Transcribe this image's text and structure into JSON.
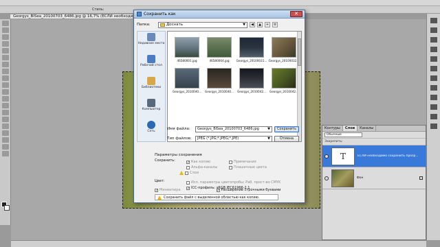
{
  "document": {
    "tab_title": "Georgys_BlSea_20100703_6486.jpg @ 16,7% (ЕСЛИ необходимо сохрани"
  },
  "options_bar": {
    "style_label": "Стиль:"
  },
  "dialog": {
    "title": "Сохранить как",
    "folder_label": "Папка:",
    "folder_value": "Доснать",
    "places": [
      {
        "label": "Недавние места",
        "color": "#6a8bb8"
      },
      {
        "label": "Рабочий стол",
        "color": "#4a7cc4"
      },
      {
        "label": "Библиотеки",
        "color": "#d6a84a"
      },
      {
        "label": "Компьютер",
        "color": "#5a6a7a"
      },
      {
        "label": "Сеть",
        "color": "#2a6ab0"
      }
    ],
    "files": [
      {
        "name": "46580001.jpg",
        "color": "#5e6f7a"
      },
      {
        "name": "46580004.jpg",
        "color": "#3f5a3a"
      },
      {
        "name": "Georgys_20100031...",
        "color": "#2a3340"
      },
      {
        "name": "Georgys_20100032...",
        "color": "#6b5a3f"
      },
      {
        "name": "Georgys_2010040...",
        "color": "#34424c"
      },
      {
        "name": "Georgys_2010040...",
        "color": "#5a4a3a"
      },
      {
        "name": "Georgys_2010042...",
        "color": "#2c2f36"
      },
      {
        "name": "Georgys_2010042...",
        "color": "#4a5a24"
      }
    ],
    "filename_label": "Имя файла:",
    "filename_value": "Georgys_BlSea_20100703_6486.jpg",
    "filetype_label": "Тип файлов:",
    "filetype_value": "JPEG (*.JPG;*.JPEG;*.JPE)",
    "save_button": "Сохранить",
    "cancel_button": "Отмена",
    "save_params_title": "Параметры сохранения",
    "save_label": "Сохранить:",
    "opt_copy": "Как копию",
    "opt_notes": "Примечания",
    "opt_alpha": "Альфа-каналы",
    "opt_spot": "Плашечные цвета",
    "opt_layers": "Слои",
    "color_label": "Цвет:",
    "opt_proof": "Исп. параметры цветопробы: Раб. прост-во CMYK",
    "opt_icc": "ICC-профиль: sRGB IEC61966-2.1",
    "opt_thumbnail": "Миниатюра",
    "opt_lowercase": "Расширение строчными буквами",
    "warning_text": "Сохранить файл с выделенной областью как копию."
  },
  "layers_panel": {
    "tabs": [
      "Контуры",
      "Слои",
      "Каналы"
    ],
    "blend_mode": "Обычные",
    "lock_label": "Закрепить:",
    "layers": [
      {
        "name": "ЕСЛИ необходимо сохранить прозр...",
        "thumb_text": "T"
      },
      {
        "name": "Фон",
        "thumb_text": ""
      }
    ]
  }
}
